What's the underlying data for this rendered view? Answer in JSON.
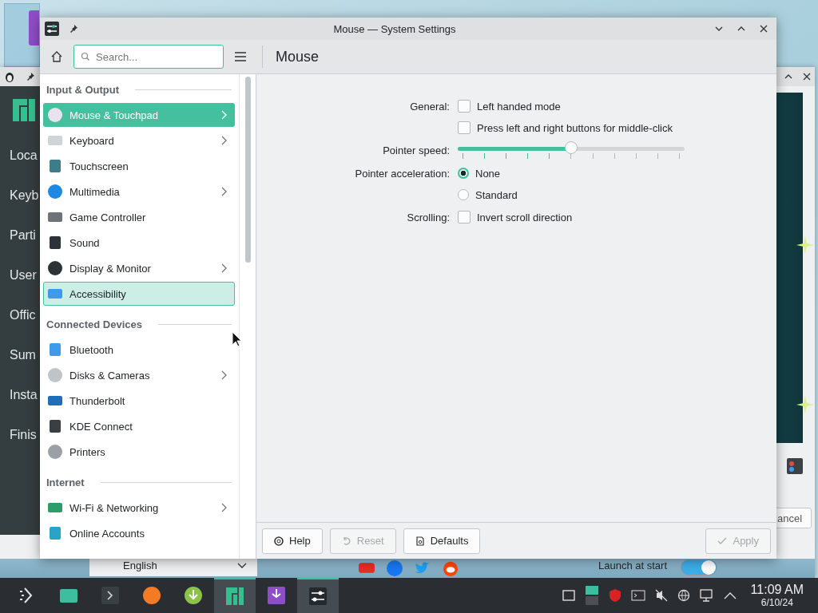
{
  "background_window": {
    "sidebar_items": [
      "Loca",
      "Keyb",
      "Parti",
      "User",
      "Offic",
      "Sum",
      "Insta",
      "Finis"
    ],
    "language": "English",
    "launch_at_start": {
      "label": "Launch at start",
      "on": true
    },
    "cancel_button": "ancel"
  },
  "window": {
    "title": "Mouse — System Settings"
  },
  "toolbar": {
    "search": {
      "placeholder": "Search..."
    },
    "page_title": "Mouse"
  },
  "sidebar": {
    "sections": [
      {
        "title": "Input & Output",
        "items": [
          {
            "label": "Mouse & Touchpad",
            "selected": true,
            "hovered": false,
            "has_children": true
          },
          {
            "label": "Keyboard",
            "selected": false,
            "hovered": false,
            "has_children": true
          },
          {
            "label": "Touchscreen",
            "selected": false,
            "hovered": false,
            "has_children": false
          },
          {
            "label": "Multimedia",
            "selected": false,
            "hovered": false,
            "has_children": true
          },
          {
            "label": "Game Controller",
            "selected": false,
            "hovered": false,
            "has_children": false
          },
          {
            "label": "Sound",
            "selected": false,
            "hovered": false,
            "has_children": false
          },
          {
            "label": "Display & Monitor",
            "selected": false,
            "hovered": false,
            "has_children": true
          },
          {
            "label": "Accessibility",
            "selected": false,
            "hovered": true,
            "has_children": false
          }
        ]
      },
      {
        "title": "Connected Devices",
        "items": [
          {
            "label": "Bluetooth",
            "selected": false,
            "hovered": false,
            "has_children": false
          },
          {
            "label": "Disks & Cameras",
            "selected": false,
            "hovered": false,
            "has_children": true
          },
          {
            "label": "Thunderbolt",
            "selected": false,
            "hovered": false,
            "has_children": false
          },
          {
            "label": "KDE Connect",
            "selected": false,
            "hovered": false,
            "has_children": false
          },
          {
            "label": "Printers",
            "selected": false,
            "hovered": false,
            "has_children": false
          }
        ]
      },
      {
        "title": "Internet",
        "items": [
          {
            "label": "Wi-Fi & Networking",
            "selected": false,
            "hovered": false,
            "has_children": true
          },
          {
            "label": "Online Accounts",
            "selected": false,
            "hovered": false,
            "has_children": false
          }
        ]
      }
    ]
  },
  "form": [
    {
      "label": "General:",
      "controls": [
        {
          "kind": "checkbox",
          "label": "Left handed mode",
          "checked": false
        },
        {
          "kind": "checkbox",
          "label": "Press left and right buttons for middle-click",
          "checked": false
        }
      ]
    },
    {
      "label": "Pointer speed:",
      "controls": [
        {
          "kind": "slider",
          "level": 0.5
        }
      ]
    },
    {
      "label": "Pointer acceleration:",
      "controls": [
        {
          "kind": "radio",
          "label": "None",
          "selected": true
        },
        {
          "kind": "radio",
          "label": "Standard",
          "selected": false
        }
      ]
    },
    {
      "label": "Scrolling:",
      "controls": [
        {
          "kind": "checkbox",
          "label": "Invert scroll direction",
          "checked": false
        }
      ]
    }
  ],
  "footer": {
    "buttons": [
      {
        "label": "Help",
        "disabled": false
      },
      {
        "label": "Reset",
        "disabled": true
      },
      {
        "label": "Defaults",
        "disabled": false
      }
    ],
    "apply": {
      "label": "Apply",
      "disabled": true
    }
  },
  "taskbar": {
    "tasks": [
      {
        "active": false
      },
      {
        "active": false
      },
      {
        "active": false
      },
      {
        "active": false
      },
      {
        "active": false
      },
      {
        "active": true
      },
      {
        "active": false
      },
      {
        "active": true
      }
    ],
    "clock": {
      "time": "11:09 AM",
      "date": "6/10/24"
    }
  }
}
